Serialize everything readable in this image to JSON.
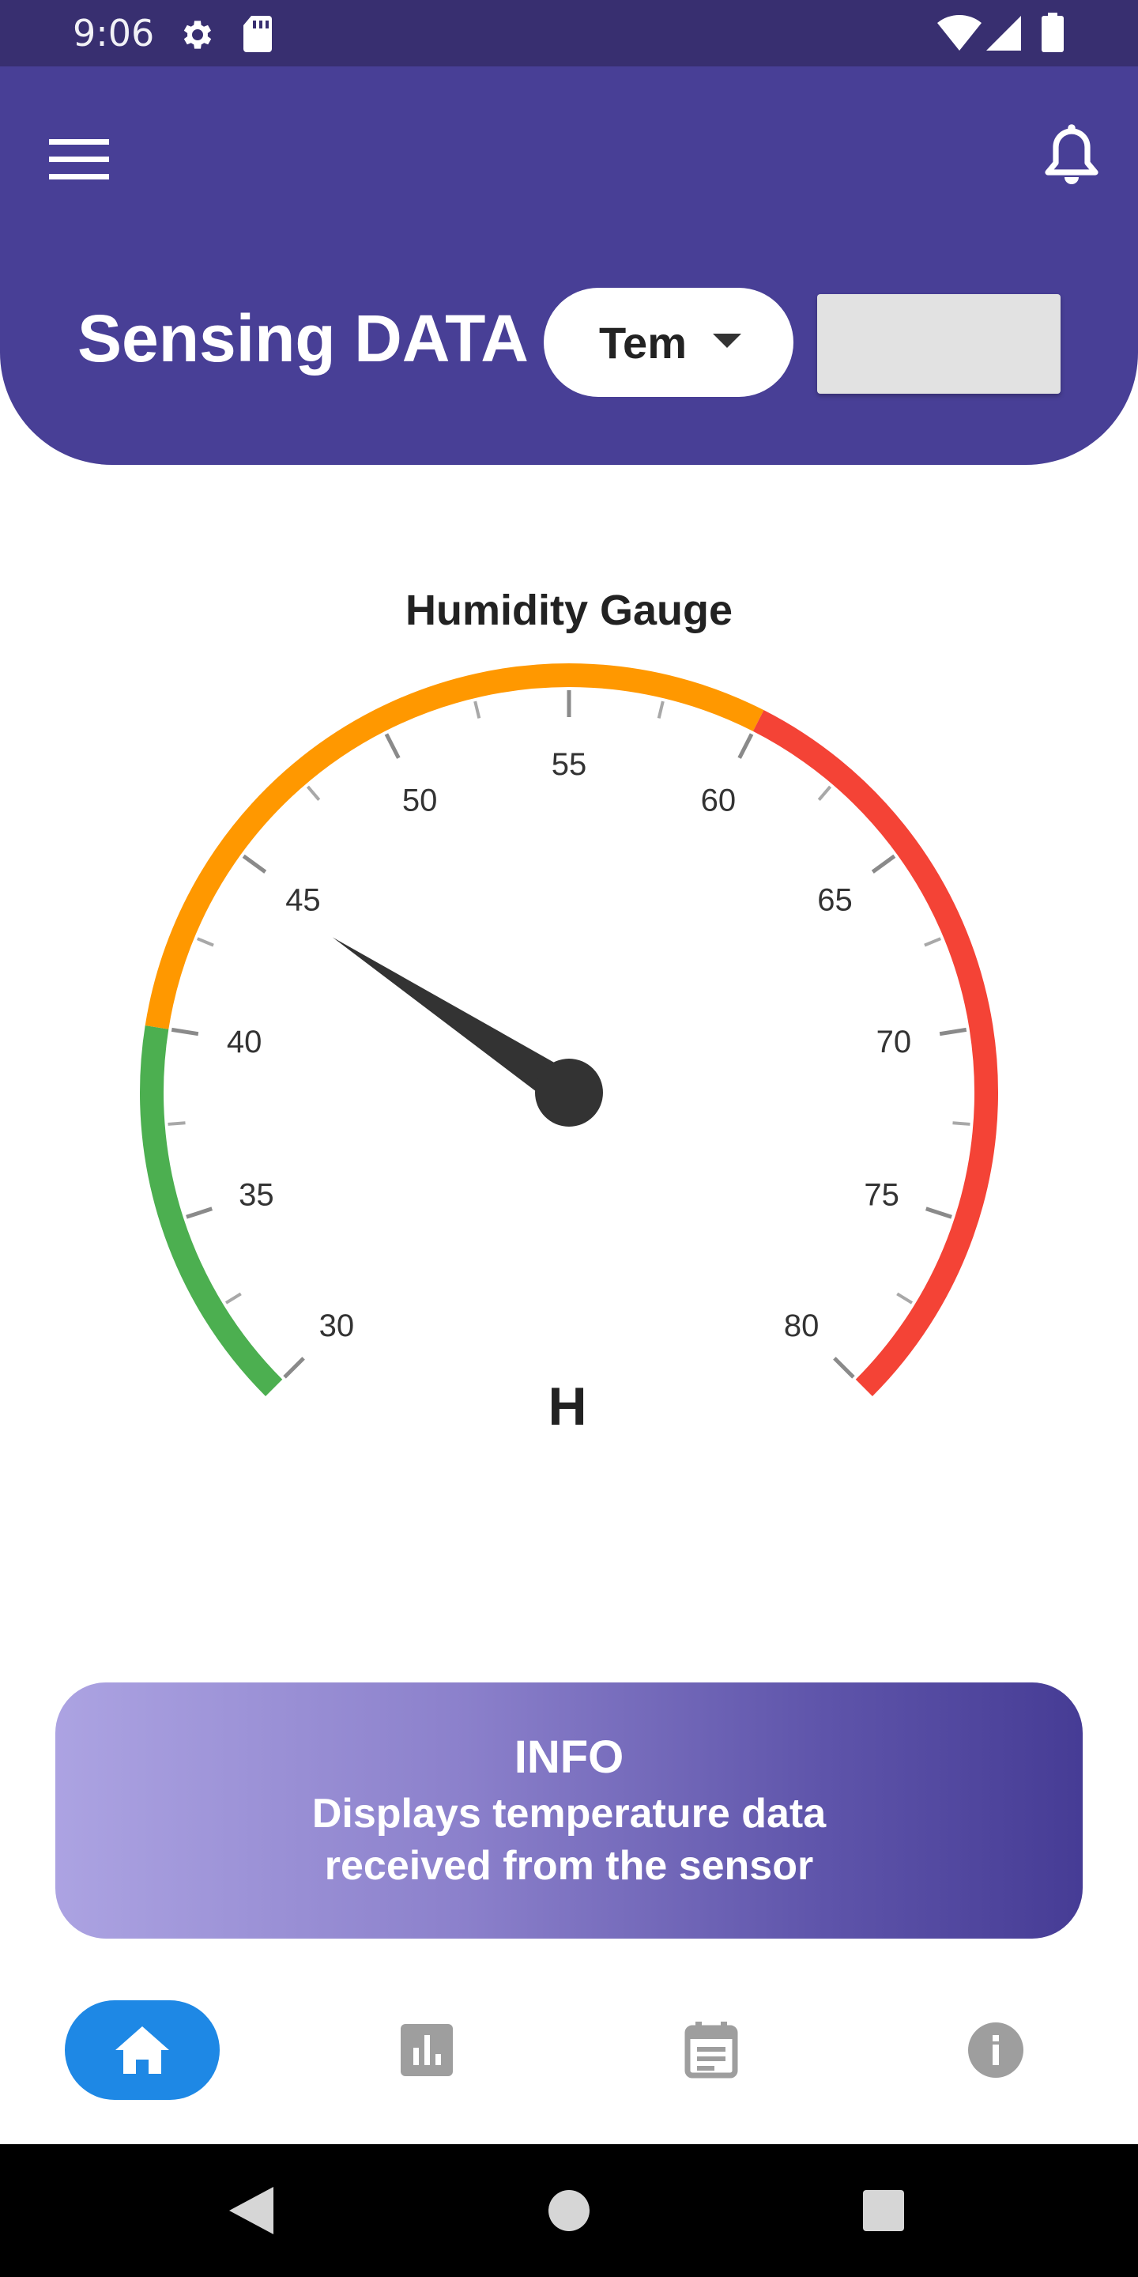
{
  "status_bar": {
    "time": "9:06",
    "icons": [
      "gear-icon",
      "sd-card-icon",
      "wifi-icon",
      "signal-icon",
      "battery-icon"
    ]
  },
  "header": {
    "menu_icon": "hamburger-menu-icon",
    "notification_icon": "bell-icon",
    "title": "Sensing DATA",
    "dropdown_selected": "Tem",
    "input_value": "",
    "background_color": "#483f96"
  },
  "gauge": {
    "title": "Humidity Gauge",
    "min": 30,
    "max": 80,
    "major_tick_step": 5,
    "minor_tick_step": 2.5,
    "tick_labels": [
      "30",
      "35",
      "40",
      "45",
      "50",
      "55",
      "60",
      "65",
      "70",
      "75",
      "80"
    ],
    "value": 44.5,
    "center_label": "H",
    "ranges": [
      {
        "from": 30,
        "to": 40,
        "color": "#4caf50"
      },
      {
        "from": 40,
        "to": 60,
        "color": "#ff9800"
      },
      {
        "from": 60,
        "to": 80,
        "color": "#f44336"
      }
    ]
  },
  "info_card": {
    "title": "INFO",
    "line1": "Displays temperature data",
    "line2": "received from the sensor"
  },
  "bottom_nav": {
    "items": [
      {
        "icon": "home-icon",
        "active": true
      },
      {
        "icon": "bar-chart-icon",
        "active": false
      },
      {
        "icon": "calendar-icon",
        "active": false
      },
      {
        "icon": "info-icon",
        "active": false
      }
    ],
    "active_color": "#1e88e5"
  },
  "system_nav": {
    "buttons": [
      "back-icon",
      "home-circle-icon",
      "recents-icon"
    ]
  }
}
